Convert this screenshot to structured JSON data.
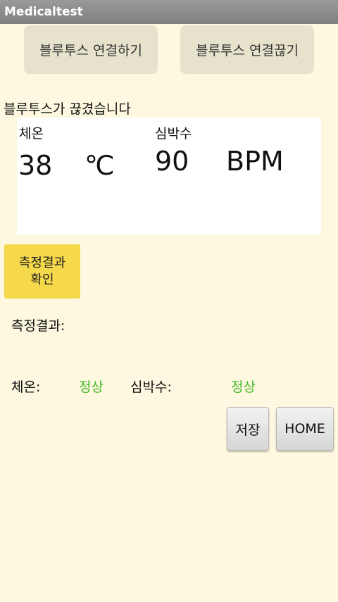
{
  "app": {
    "title": "Medicaltest"
  },
  "buttons": {
    "connect": "블루투스 연결하기",
    "disconnect": "블루투스 연결끊기",
    "check": [
      "측정결과",
      "확인"
    ],
    "save": "저장",
    "home": "HOME"
  },
  "status": "블루투스가 끊겼습니다",
  "panel": {
    "temp_label": "체온",
    "temp_value": "38",
    "temp_unit": "℃",
    "hr_label": "심박수",
    "hr_value": "90",
    "hr_unit": "BPM"
  },
  "result": {
    "heading": "측정결과:",
    "temp_label": "체온:",
    "temp_status": "정상",
    "hr_label": "심박수:",
    "hr_status": "정상"
  },
  "colors": {
    "status_ok": "#3fb824",
    "check_button": "#f5d94a",
    "background": "#fdf8df"
  }
}
